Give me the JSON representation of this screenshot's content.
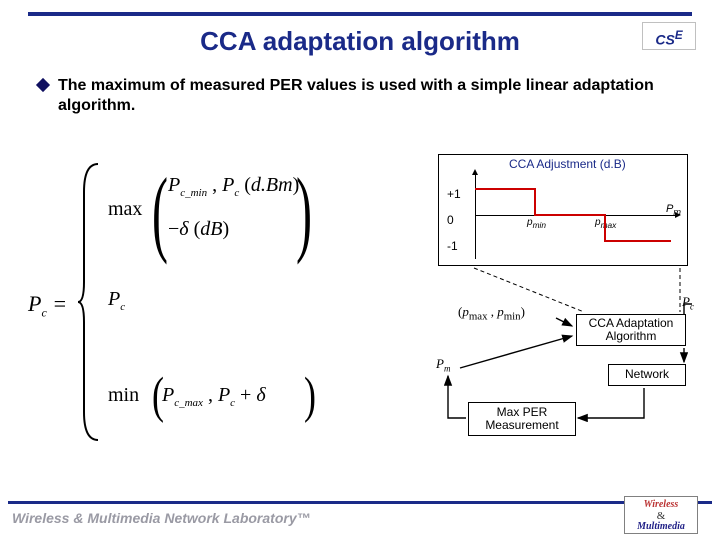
{
  "header": {
    "title": "CCA adaptation algorithm",
    "logo": {
      "c": "C",
      "s": "S",
      "e": "E"
    }
  },
  "bullet": {
    "text": "The maximum of measured PER values is used with a simple linear adaptation algorithm."
  },
  "equation": {
    "lhs": "P",
    "lhs_sub": "c",
    "eq_sign": " = ",
    "case1_fn": "max",
    "case1_a_sym": "P",
    "case1_a_sub": "c_min",
    "case1_sep": " , ",
    "case1_b_sym": "P",
    "case1_b_sub": "c",
    "case1_b_arg": "d.Bm",
    "case2_a_sep": "−",
    "case2_a_sym": "δ",
    "case2_a_arg": "dB",
    "mid_sym": "P",
    "mid_sub": "c",
    "case3_fn": "min",
    "case3_a_sym": "P",
    "case3_a_sub": "c_max",
    "case3_sep": " , ",
    "case3_b_sym": "P",
    "case3_b_sub": "c",
    "case3_b_plus": " + ",
    "case3_b_delta": "δ"
  },
  "diagram": {
    "adjust_title": "CCA Adjustment (d.B)",
    "ticks": {
      "plus1": "+1",
      "zero": "0",
      "minus1": "-1"
    },
    "x_right_label": "P",
    "x_right_sub": "m",
    "p_min_label": "p",
    "p_min_sub": "min",
    "p_max_label": "p",
    "p_max_sub": "max",
    "pair_open": "(",
    "pair_a_sym": "p",
    "pair_a_sub": "max",
    "pair_mid": " ,  ",
    "pair_b_sym": "p",
    "pair_b_sub": "min",
    "pair_close": ")",
    "pm_sym": "P",
    "pm_sub": "m",
    "pc_sym": "P",
    "pc_sub": "c",
    "block_alg": "CCA Adaptation Algorithm",
    "block_net": "Network",
    "block_max": "Max  PER Measurement"
  },
  "footer": {
    "text": "Wireless & Multimedia Network Laboratory™",
    "logo_line1": "Wireless",
    "logo_amp": "&",
    "logo_line2": "Multimedia"
  }
}
